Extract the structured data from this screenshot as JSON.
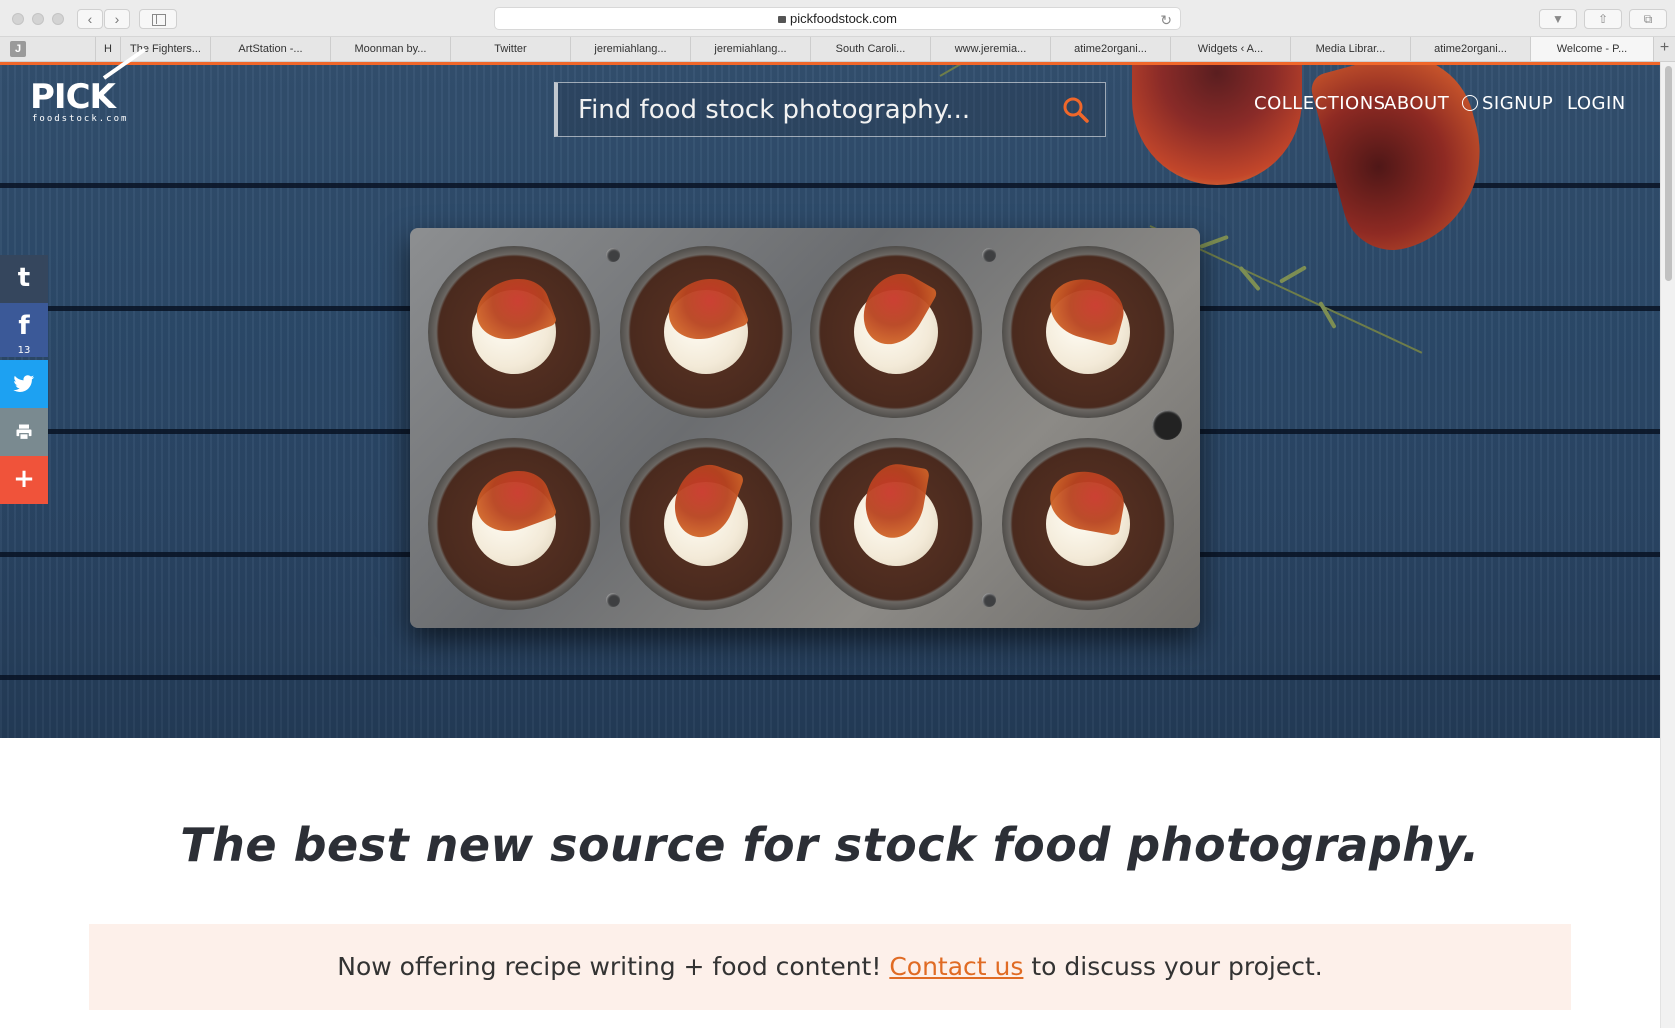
{
  "browser": {
    "url": "pickfoodstock.com",
    "bookmark_icon": "J",
    "tabs": [
      {
        "label": "H"
      },
      {
        "label": "The Fighters..."
      },
      {
        "label": "ArtStation -..."
      },
      {
        "label": "Moonman by..."
      },
      {
        "label": "Twitter"
      },
      {
        "label": "jeremiahlang..."
      },
      {
        "label": "jeremiahlang..."
      },
      {
        "label": "South Caroli..."
      },
      {
        "label": "www.jeremia..."
      },
      {
        "label": "atime2organi..."
      },
      {
        "label": "Widgets ‹ A..."
      },
      {
        "label": "Media Librar..."
      },
      {
        "label": "atime2organi..."
      },
      {
        "label": "Welcome - P..."
      }
    ],
    "add_tab": "+"
  },
  "header": {
    "logo_main": "PICK",
    "logo_sub": "foodstock.com",
    "search_placeholder": "Find food stock photography...",
    "nav": {
      "collections": "COLLECTIONS",
      "about": "ABOUT",
      "signup": "SIGNUP",
      "login": "LOGIN"
    }
  },
  "share": {
    "tumblr": "t",
    "facebook": "f",
    "facebook_count": "13",
    "twitter_icon": "twitter-bird",
    "print_icon": "printer",
    "more": "+"
  },
  "colors": {
    "accent": "#f0672a",
    "tumblr": "#35465d",
    "facebook": "#3b5998",
    "twitter": "#1da1f2",
    "print": "#7a8a90",
    "more": "#f0533a",
    "banner_bg": "#fdf0ea"
  },
  "content": {
    "tagline": "The best new source for stock food photography.",
    "banner_before": "Now offering recipe writing + food content! ",
    "banner_link": "Contact us",
    "banner_after": " to discuss your project."
  }
}
